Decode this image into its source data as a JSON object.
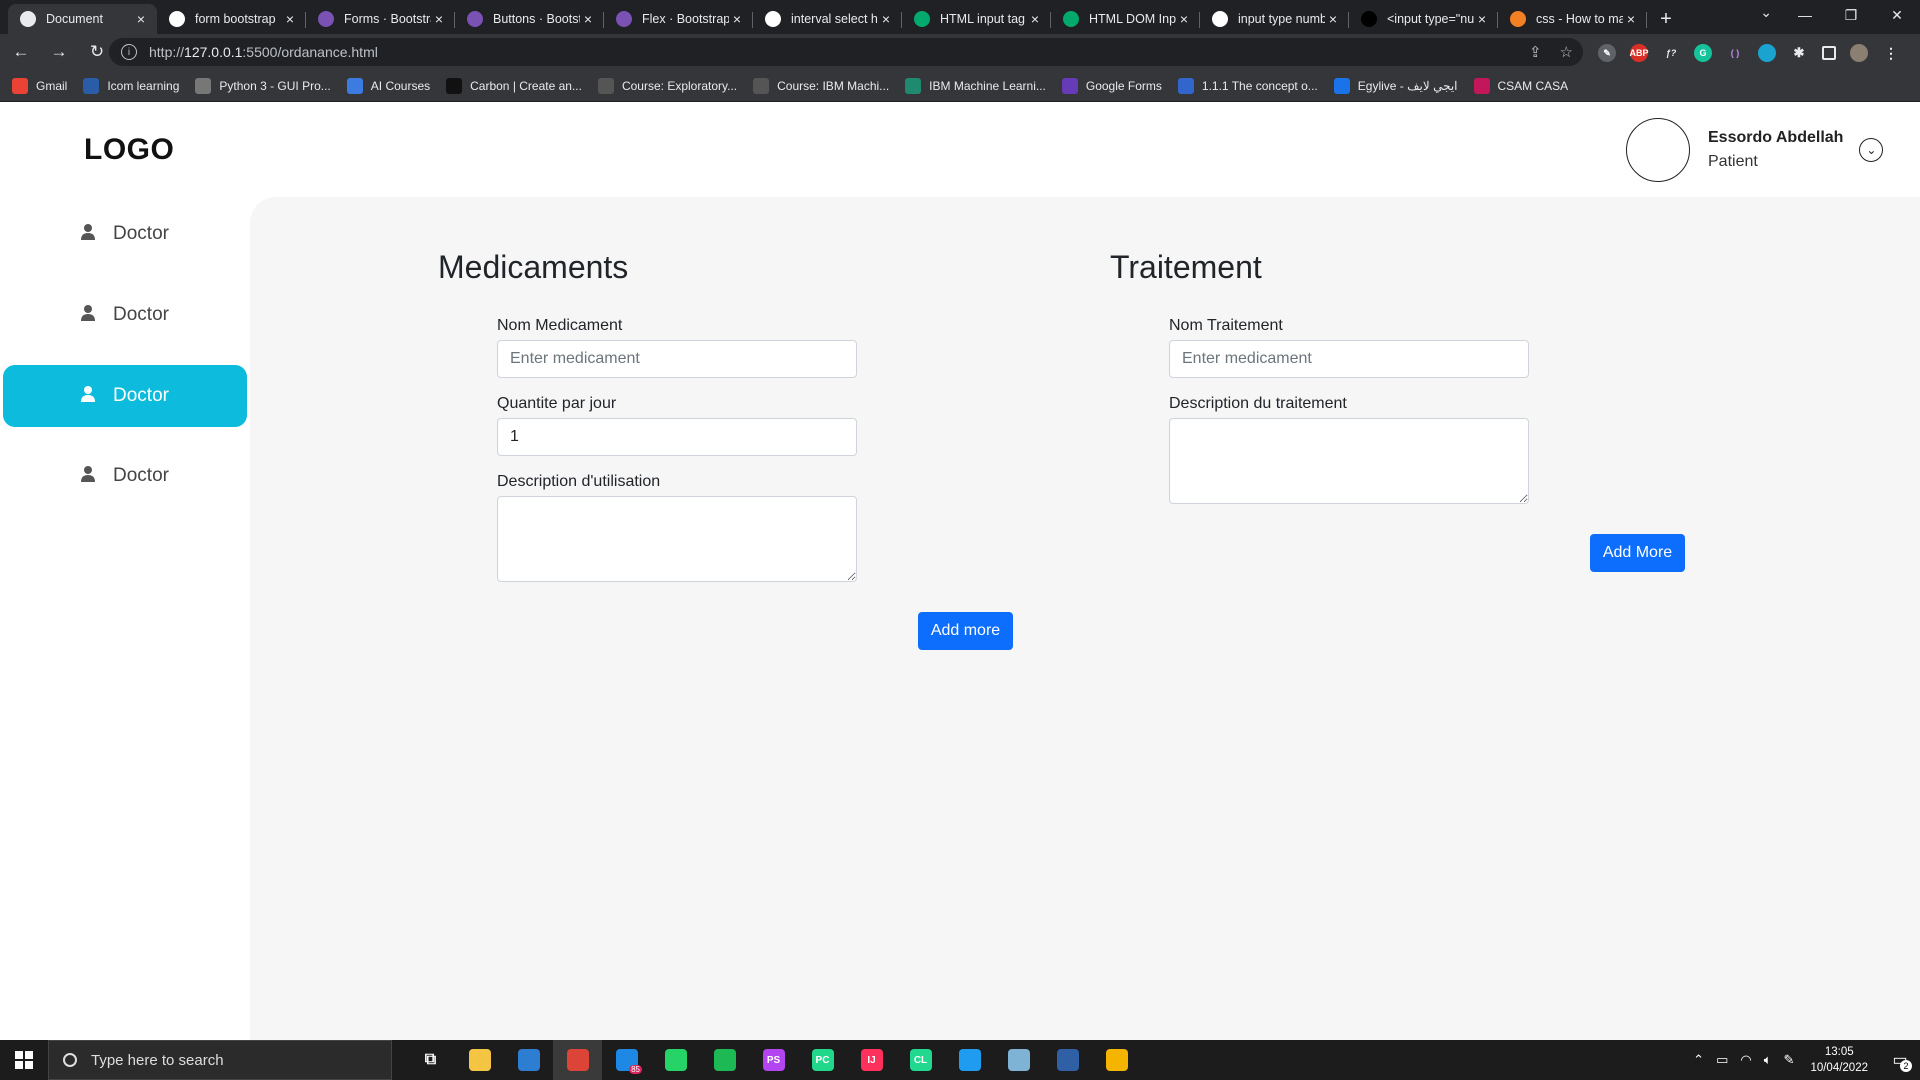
{
  "browser": {
    "tabs": [
      {
        "title": "Document",
        "icon": "chrome-icon",
        "color": "#e8eaed",
        "active": true
      },
      {
        "title": "form bootstrap",
        "icon": "google-icon",
        "color": "#ffffff"
      },
      {
        "title": "Forms · Bootstrap",
        "icon": "bootstrap-icon",
        "color": "#7952b3"
      },
      {
        "title": "Buttons · Bootstrap",
        "icon": "bootstrap-icon",
        "color": "#7952b3"
      },
      {
        "title": "Flex · Bootstrap",
        "icon": "bootstrap-icon",
        "color": "#7952b3"
      },
      {
        "title": "interval select html",
        "icon": "google-icon",
        "color": "#ffffff"
      },
      {
        "title": "HTML input tag",
        "icon": "w3schools-icon",
        "color": "#04aa6d"
      },
      {
        "title": "HTML DOM Input",
        "icon": "w3schools-icon",
        "color": "#04aa6d"
      },
      {
        "title": "input type number",
        "icon": "google-icon",
        "color": "#ffffff"
      },
      {
        "title": "<input type=\"number\">",
        "icon": "mdn-icon",
        "color": "#000000"
      },
      {
        "title": "css - How to make",
        "icon": "stackoverflow-icon",
        "color": "#f48024"
      }
    ],
    "url_prefix": "http://",
    "url_host": "127.0.0.1",
    "url_rest": ":5500/ordanance.html",
    "bookmarks": [
      {
        "label": "Gmail",
        "color": "#ea4335"
      },
      {
        "label": "Icom learning",
        "color": "#2a5ca8"
      },
      {
        "label": "Python 3 - GUI Pro...",
        "color": "#777777"
      },
      {
        "label": "AI Courses",
        "color": "#3c7be0"
      },
      {
        "label": "Carbon | Create an...",
        "color": "#111111"
      },
      {
        "label": "Course: Exploratory...",
        "color": "#555555"
      },
      {
        "label": "Course: IBM Machi...",
        "color": "#555555"
      },
      {
        "label": "IBM Machine Learni...",
        "color": "#1f8a70"
      },
      {
        "label": "Google Forms",
        "color": "#673ab7"
      },
      {
        "label": "1.1.1 The concept o...",
        "color": "#3366cc"
      },
      {
        "label": "Egylive - ايجي لايف",
        "color": "#1a73e8"
      },
      {
        "label": "CSAM CASA",
        "color": "#c2185b"
      }
    ]
  },
  "header": {
    "logo": "LOGO",
    "user_name": "Essordo Abdellah",
    "user_role": "Patient"
  },
  "sidebar": {
    "items": [
      {
        "label": "Doctor",
        "active": false
      },
      {
        "label": "Doctor",
        "active": false
      },
      {
        "label": "Doctor",
        "active": true
      },
      {
        "label": "Doctor",
        "active": false
      }
    ],
    "active_color": "#0dbbdc"
  },
  "medicaments": {
    "title": "Medicaments",
    "nom_label": "Nom Medicament",
    "nom_placeholder": "Enter medicament",
    "quantite_label": "Quantite par jour",
    "quantite_value": "1",
    "description_label": "Description d'utilisation",
    "add_button": "Add more"
  },
  "traitement": {
    "title": "Traitement",
    "nom_label": "Nom Traitement",
    "nom_placeholder": "Enter medicament",
    "description_label": "Description du traitement",
    "add_button": "Add More"
  },
  "taskbar": {
    "search_placeholder": "Type here to search",
    "mail_badge": "85",
    "time": "13:05",
    "date": "10/04/2022",
    "notifications": "2",
    "apps": [
      {
        "name": "task-view-icon",
        "color": "#1c1c1c",
        "glyph": "⧉"
      },
      {
        "name": "file-explorer-icon",
        "color": "#f4c542",
        "glyph": ""
      },
      {
        "name": "store-icon",
        "color": "#2d7dd2",
        "glyph": ""
      },
      {
        "name": "chrome-taskbar-icon",
        "color": "#db4437",
        "glyph": "",
        "active": true
      },
      {
        "name": "mail-icon",
        "color": "#1e88e5",
        "glyph": ""
      },
      {
        "name": "whatsapp-icon",
        "color": "#25d366",
        "glyph": ""
      },
      {
        "name": "spotify-icon",
        "color": "#1db954",
        "glyph": ""
      },
      {
        "name": "phpstorm-icon",
        "color": "#b345f1",
        "glyph": "PS"
      },
      {
        "name": "pycharm-icon",
        "color": "#21d789",
        "glyph": "PC"
      },
      {
        "name": "intellij-icon",
        "color": "#fe315d",
        "glyph": "IJ"
      },
      {
        "name": "clion-icon",
        "color": "#22d88f",
        "glyph": "CL"
      },
      {
        "name": "vscode-icon",
        "color": "#1f9cf0",
        "glyph": ""
      },
      {
        "name": "notepad-icon",
        "color": "#7fb3d5",
        "glyph": ""
      },
      {
        "name": "virtualbox-icon",
        "color": "#2f5fa5",
        "glyph": ""
      },
      {
        "name": "chrome-second-icon",
        "color": "#f4b400",
        "glyph": ""
      }
    ]
  }
}
